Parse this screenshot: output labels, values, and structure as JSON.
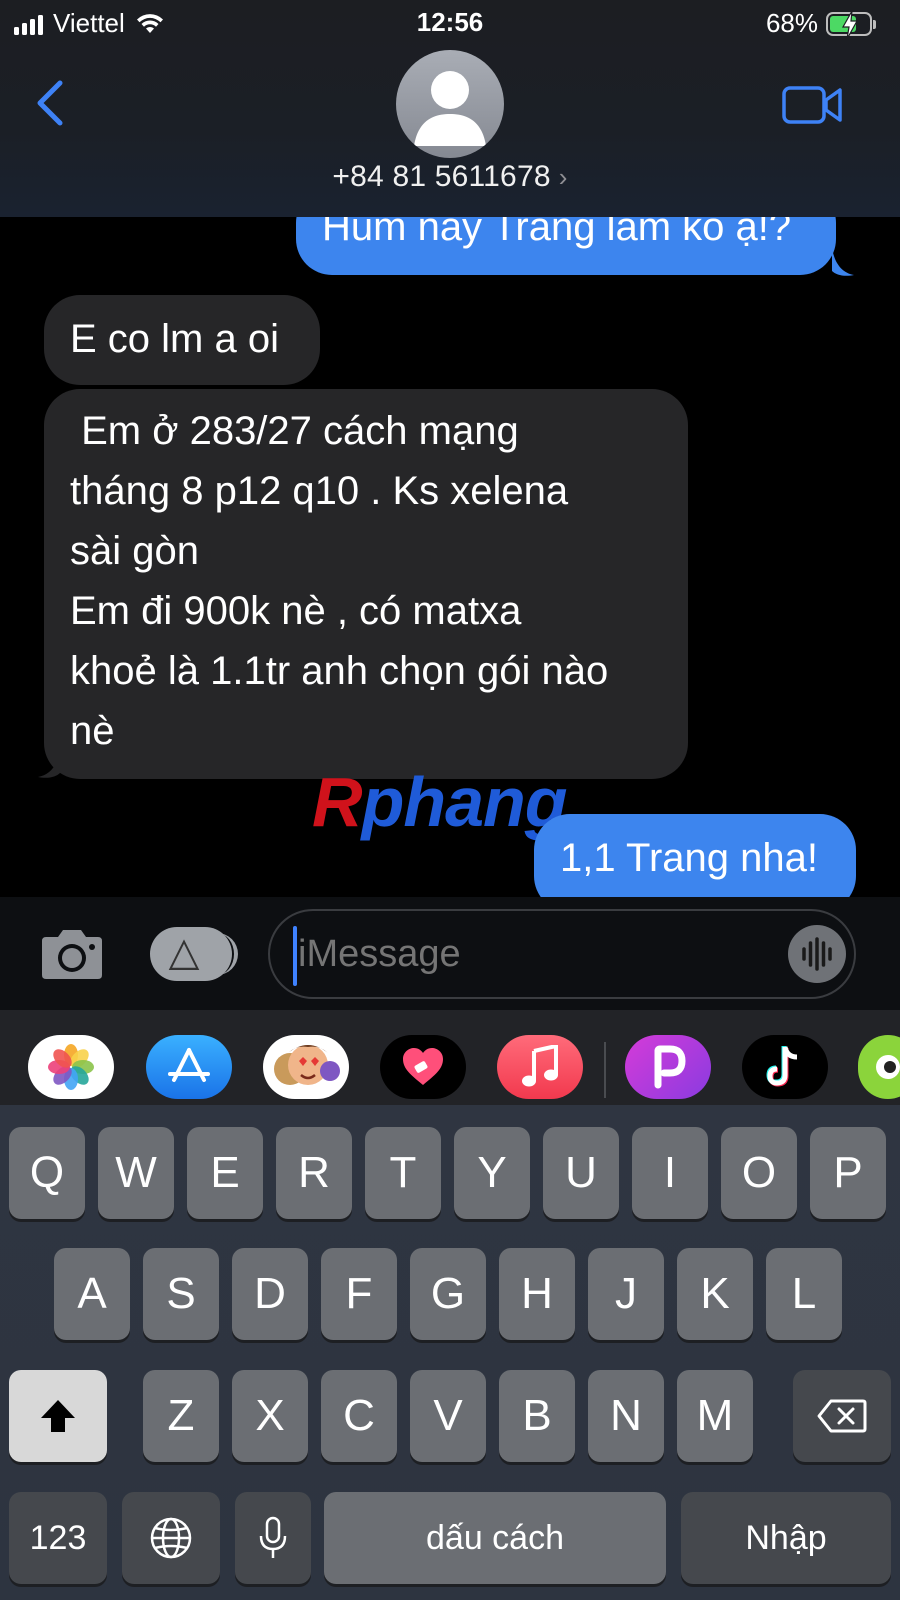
{
  "status": {
    "carrier": "Viettel",
    "time": "12:56",
    "battery_percent": "68%",
    "battery_level": 0.68
  },
  "header": {
    "contact": "+84 81 5611678"
  },
  "messages": [
    {
      "dir": "out",
      "text": "Hum nay Trang làm ko ạ!?"
    },
    {
      "dir": "in",
      "text": "E co lm a oi"
    },
    {
      "dir": "in",
      "lines": [
        " Em ở 283/27 cách mạng",
        "tháng 8 p12 q10 . Ks xelena",
        "sài gòn",
        "Em đi 900k nè , có matxa",
        "khoẻ là 1.1tr anh chọn gói nào",
        "nè"
      ]
    },
    {
      "dir": "out",
      "text": "1,1 Trang nha!"
    }
  ],
  "watermark": {
    "first": "R",
    "rest": "phang"
  },
  "compose": {
    "placeholder": "iMessage"
  },
  "app_drawer": [
    "photos-app",
    "app-store",
    "memoji",
    "digital-touch",
    "music",
    "picsart",
    "tiktok",
    "more-app"
  ],
  "keyboard": {
    "row1": [
      "Q",
      "W",
      "E",
      "R",
      "T",
      "Y",
      "U",
      "I",
      "O",
      "P"
    ],
    "row2": [
      "A",
      "S",
      "D",
      "F",
      "G",
      "H",
      "J",
      "K",
      "L"
    ],
    "row3": [
      "Z",
      "X",
      "C",
      "V",
      "B",
      "N",
      "M"
    ],
    "numbers_label": "123",
    "space_label": "dấu cách",
    "return_label": "Nhập"
  },
  "colors": {
    "outgoing_bubble": "#3d85ee",
    "incoming_bubble": "#262628",
    "accent": "#3f82ff"
  }
}
